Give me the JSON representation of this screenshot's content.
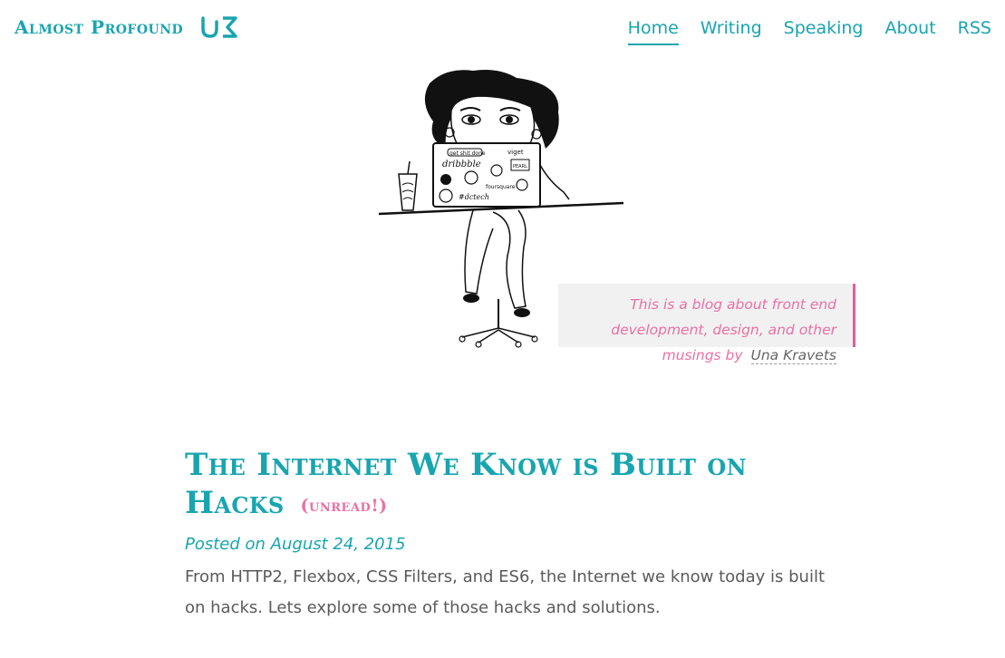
{
  "header": {
    "brand": "Almost Profound",
    "logo_icon": "uk-monogram-logo"
  },
  "nav": {
    "items": [
      {
        "label": "Home",
        "active": true
      },
      {
        "label": "Writing",
        "active": false
      },
      {
        "label": "Speaking",
        "active": false
      },
      {
        "label": "About",
        "active": false
      },
      {
        "label": "RSS",
        "active": false
      }
    ]
  },
  "hero": {
    "illustration": "woman-at-laptop-illustration",
    "tagline_text": "This is a blog about front end development, design, and other musings by",
    "tagline_author": "Una Kravets"
  },
  "post": {
    "title": "The Internet We Know is Built on Hacks",
    "badge": "(unread!)",
    "date": "Posted on August 24, 2015",
    "excerpt": "From HTTP2, Flexbox, CSS Filters, and ES6, the Internet we know today is built on hacks. Lets explore some of those hacks and solutions."
  },
  "colors": {
    "accent": "#18a5b0",
    "pink": "#ec6fa3",
    "tagline_bg": "#f1f1f1"
  }
}
